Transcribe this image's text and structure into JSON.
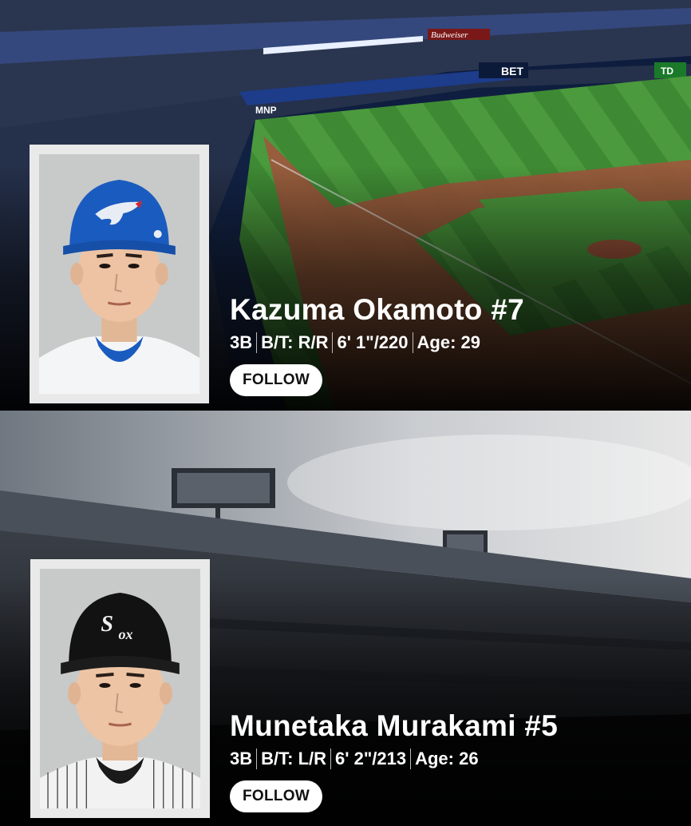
{
  "players": [
    {
      "name": "Kazuma Okamoto #7",
      "position": "3B",
      "bats_throws": "B/T: R/R",
      "height_weight": "6' 1\"/220",
      "age": "Age: 29",
      "follow_label": "FOLLOW",
      "cap_color": "#1a5bbf",
      "team_logo": "blue-jays-logo"
    },
    {
      "name": "Munetaka Murakami #5",
      "position": "3B",
      "bats_throws": "B/T: L/R",
      "height_weight": "6' 2\"/213",
      "age": "Age: 26",
      "follow_label": "FOLLOW",
      "cap_color": "#111111",
      "team_logo": "white-sox-logo"
    }
  ],
  "stadium_signage": {
    "sign1": "Budweiser",
    "sign2": "BET",
    "sign3": "MNP",
    "sign4": "TD"
  }
}
